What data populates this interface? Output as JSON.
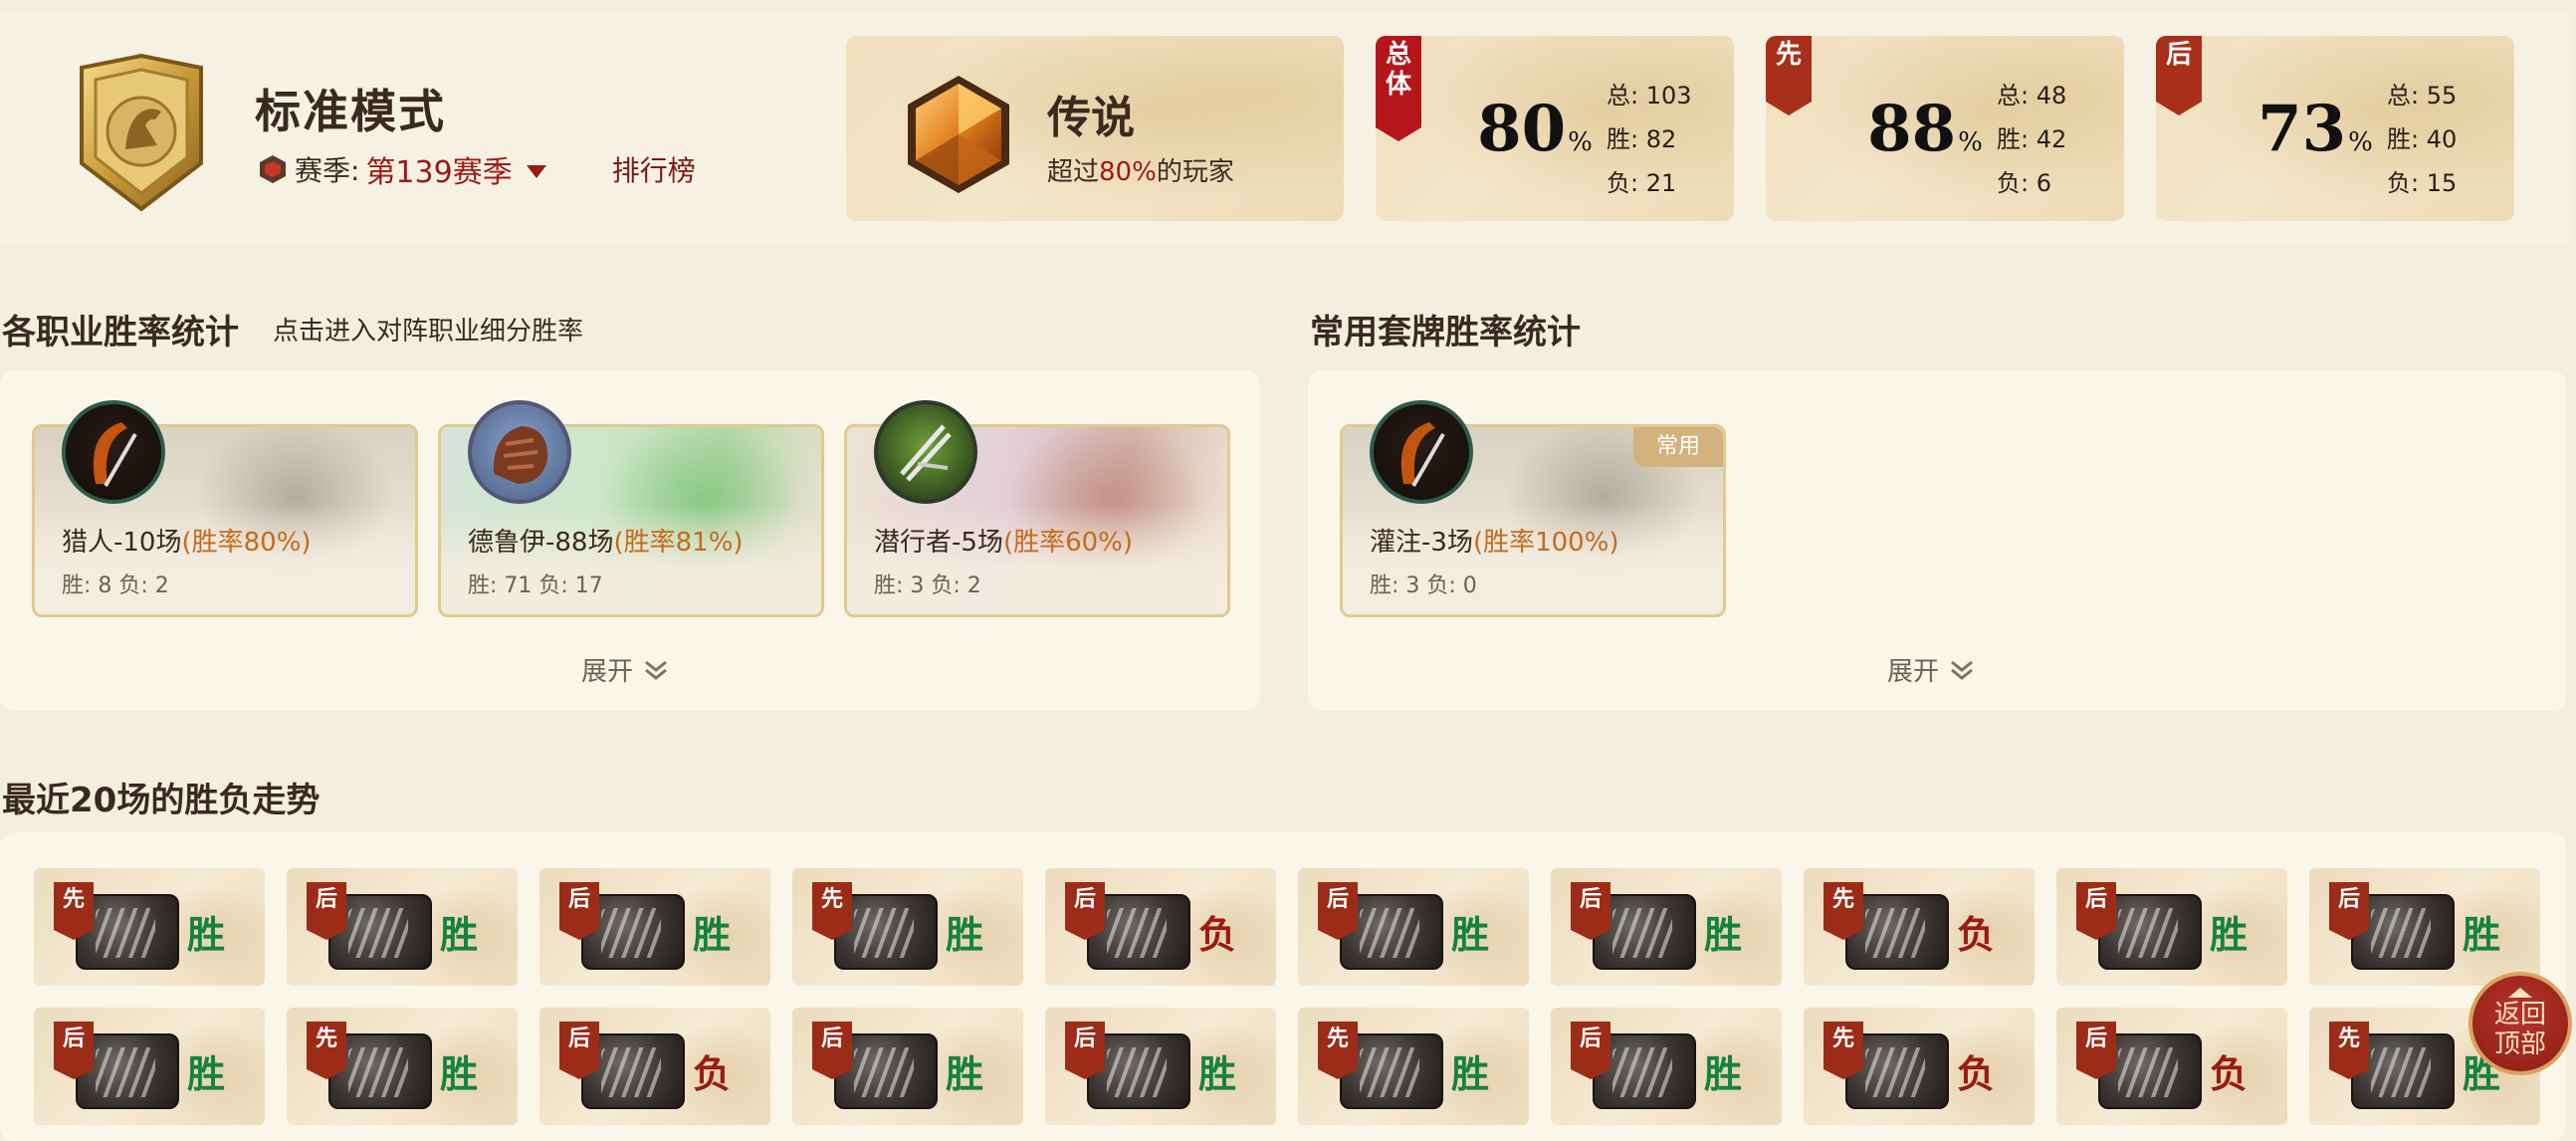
{
  "header": {
    "mode_title": "标准模式",
    "season_label": "赛季:",
    "season_value": "第139赛季",
    "rank_link": "排行榜",
    "legend": {
      "title": "传说",
      "sub_prefix": "超过",
      "sub_value": "80%",
      "sub_suffix": "的玩家"
    },
    "stats": [
      {
        "tag": "总体",
        "rate": "80",
        "pct": "%",
        "total": "总: 103",
        "win": "胜: 82",
        "lose": "负: 21"
      },
      {
        "tag": "先",
        "rate": "88",
        "pct": "%",
        "total": "总: 48",
        "win": "胜: 42",
        "lose": "负: 6"
      },
      {
        "tag": "后",
        "rate": "73",
        "pct": "%",
        "total": "总: 55",
        "win": "胜: 40",
        "lose": "负: 15"
      }
    ]
  },
  "class_section": {
    "title": "各职业胜率统计",
    "hint": "点击进入对阵职业细分胜率",
    "cards": [
      {
        "name": "猎人-10场",
        "rate": "(胜率80%)",
        "record": "胜: 8 负: 2"
      },
      {
        "name": "德鲁伊-88场",
        "rate": "(胜率81%)",
        "record": "胜: 71 负: 17"
      },
      {
        "name": "潜行者-5场",
        "rate": "(胜率60%)",
        "record": "胜: 3 负: 2"
      }
    ],
    "expand": "展开"
  },
  "deck_section": {
    "title": "常用套牌胜率统计",
    "cards": [
      {
        "name": "灌注-3场",
        "rate": "(胜率100%)",
        "record": "胜: 3 负: 0",
        "tag": "常用"
      }
    ],
    "expand": "展开"
  },
  "trend_section": {
    "title": "最近20场的胜负走势",
    "games": [
      {
        "side": "先",
        "result": "胜"
      },
      {
        "side": "后",
        "result": "胜"
      },
      {
        "side": "后",
        "result": "胜"
      },
      {
        "side": "先",
        "result": "胜"
      },
      {
        "side": "后",
        "result": "负"
      },
      {
        "side": "后",
        "result": "胜"
      },
      {
        "side": "后",
        "result": "胜"
      },
      {
        "side": "先",
        "result": "负"
      },
      {
        "side": "后",
        "result": "胜"
      },
      {
        "side": "后",
        "result": "胜"
      },
      {
        "side": "后",
        "result": "胜"
      },
      {
        "side": "先",
        "result": "胜"
      },
      {
        "side": "后",
        "result": "负"
      },
      {
        "side": "后",
        "result": "胜"
      },
      {
        "side": "后",
        "result": "胜"
      },
      {
        "side": "先",
        "result": "胜"
      },
      {
        "side": "后",
        "result": "胜"
      },
      {
        "side": "先",
        "result": "负"
      },
      {
        "side": "后",
        "result": "负"
      },
      {
        "side": "先",
        "result": "胜"
      }
    ]
  },
  "back_to_top": {
    "line1": "返回",
    "line2": "顶部"
  },
  "colors": {
    "win": "#15823f",
    "lose": "#9b1a14",
    "accent": "#9b1a14",
    "rate_orange": "#c56a1c"
  }
}
